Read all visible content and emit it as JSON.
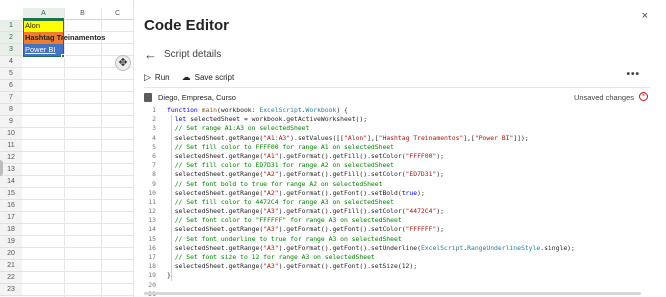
{
  "sheet": {
    "columns": [
      "A",
      "B",
      "C"
    ],
    "rows": [
      "1",
      "2",
      "3",
      "4",
      "5",
      "6",
      "7",
      "8",
      "9",
      "10",
      "11",
      "12",
      "13",
      "14",
      "15",
      "16",
      "17",
      "18",
      "19",
      "20",
      "21",
      "22",
      "23"
    ],
    "cells": {
      "a1": "Alon",
      "a2": "Hashtag Treinamentos",
      "a3": "Power BI"
    },
    "colors": {
      "a1_fill": "#FFFF00",
      "a2_fill": "#ED7D31",
      "a3_fill": "#4472C4",
      "a3_font": "#FFFFFF",
      "selection": "#217346"
    }
  },
  "editor": {
    "title": "Code Editor",
    "close_icon": "×",
    "back_icon": "←",
    "subtitle": "Script details",
    "run_icon": "▷",
    "run_label": "Run",
    "save_icon": "☁",
    "save_label": "Save script",
    "more_icon": "•••",
    "file_name": "Diego, Empresa, Curso",
    "unsaved_label": "Unsaved changes",
    "unsaved_icon": "×"
  },
  "code": {
    "line_numbers": [
      "1",
      "2",
      "3",
      "4",
      "5",
      "6",
      "7",
      "8",
      "9",
      "10",
      "11",
      "12",
      "13",
      "14",
      "15",
      "16",
      "17",
      "18",
      "19",
      "20",
      "21"
    ],
    "lines": [
      [
        {
          "t": "function ",
          "c": "kw"
        },
        {
          "t": "main",
          "c": "fn"
        },
        {
          "t": "(workbook: ",
          "c": ""
        },
        {
          "t": "ExcelScript",
          "c": "ty"
        },
        {
          "t": ".",
          "c": ""
        },
        {
          "t": "Workbook",
          "c": "ty"
        },
        {
          "t": ") {",
          "c": ""
        }
      ],
      [
        {
          "t": "  ",
          "c": ""
        },
        {
          "t": "let ",
          "c": "kw"
        },
        {
          "t": "selectedSheet = workbook.getActiveWorksheet();",
          "c": ""
        }
      ],
      [
        {
          "t": "  // Set range A1:A3 on selectedSheet",
          "c": "cm"
        }
      ],
      [
        {
          "t": "  selectedSheet.getRange(",
          "c": ""
        },
        {
          "t": "\"A1:A3\"",
          "c": "st"
        },
        {
          "t": ").setValues([[",
          "c": ""
        },
        {
          "t": "\"Alon\"",
          "c": "st"
        },
        {
          "t": "],[",
          "c": ""
        },
        {
          "t": "\"Hashtag Treinamentos\"",
          "c": "st"
        },
        {
          "t": "],[",
          "c": ""
        },
        {
          "t": "\"Power BI\"",
          "c": "st"
        },
        {
          "t": "]]);",
          "c": ""
        }
      ],
      [
        {
          "t": "  // Set fill color to FFFF00 for range A1 on selectedSheet",
          "c": "cm"
        }
      ],
      [
        {
          "t": "  selectedSheet.getRange(",
          "c": ""
        },
        {
          "t": "\"A1\"",
          "c": "st"
        },
        {
          "t": ").getFormat().getFill().setColor(",
          "c": ""
        },
        {
          "t": "\"FFFF00\"",
          "c": "st"
        },
        {
          "t": ");",
          "c": ""
        }
      ],
      [
        {
          "t": "  // Set fill color to ED7D31 for range A2 on selectedSheet",
          "c": "cm"
        }
      ],
      [
        {
          "t": "  selectedSheet.getRange(",
          "c": ""
        },
        {
          "t": "\"A2\"",
          "c": "st"
        },
        {
          "t": ").getFormat().getFill().setColor(",
          "c": ""
        },
        {
          "t": "\"ED7D31\"",
          "c": "st"
        },
        {
          "t": ");",
          "c": ""
        }
      ],
      [
        {
          "t": "  // Set font bold to true for range A2 on selectedSheet",
          "c": "cm"
        }
      ],
      [
        {
          "t": "  selectedSheet.getRange(",
          "c": ""
        },
        {
          "t": "\"A2\"",
          "c": "st"
        },
        {
          "t": ").getFormat().getFont().setBold(",
          "c": ""
        },
        {
          "t": "true",
          "c": "kw"
        },
        {
          "t": ");",
          "c": ""
        }
      ],
      [
        {
          "t": "  // Set fill color to 4472C4 for range A3 on selectedSheet",
          "c": "cm"
        }
      ],
      [
        {
          "t": "  selectedSheet.getRange(",
          "c": ""
        },
        {
          "t": "\"A3\"",
          "c": "st"
        },
        {
          "t": ").getFormat().getFill().setColor(",
          "c": ""
        },
        {
          "t": "\"4472C4\"",
          "c": "st"
        },
        {
          "t": ");",
          "c": ""
        }
      ],
      [
        {
          "t": "  // Set font color to \"FFFFFF\" for range A3 on selectedSheet",
          "c": "cm"
        }
      ],
      [
        {
          "t": "  selectedSheet.getRange(",
          "c": ""
        },
        {
          "t": "\"A3\"",
          "c": "st"
        },
        {
          "t": ").getFormat().getFont().setColor(",
          "c": ""
        },
        {
          "t": "\"FFFFFF\"",
          "c": "st"
        },
        {
          "t": ");",
          "c": ""
        }
      ],
      [
        {
          "t": "  // Set font underline to true for range A3 on selectedSheet",
          "c": "cm"
        }
      ],
      [
        {
          "t": "  selectedSheet.getRange(",
          "c": ""
        },
        {
          "t": "\"A3\"",
          "c": "st"
        },
        {
          "t": ").getFormat().getFont().setUnderline(",
          "c": ""
        },
        {
          "t": "ExcelScript",
          "c": "ty"
        },
        {
          "t": ".",
          "c": ""
        },
        {
          "t": "RangeUnderlineStyle",
          "c": "ty"
        },
        {
          "t": ".single);",
          "c": ""
        }
      ],
      [
        {
          "t": "  // Set font size to 12 for range A3 on selectedSheet",
          "c": "cm"
        }
      ],
      [
        {
          "t": "  selectedSheet.getRange(",
          "c": ""
        },
        {
          "t": "\"A3\"",
          "c": "st"
        },
        {
          "t": ").getFormat().getFont().setSize(",
          "c": ""
        },
        {
          "t": "12",
          "c": "nm"
        },
        {
          "t": ");",
          "c": ""
        }
      ],
      [
        {
          "t": "}",
          "c": ""
        }
      ],
      [
        {
          "t": "",
          "c": ""
        }
      ],
      [
        {
          "t": "",
          "c": ""
        }
      ]
    ]
  }
}
